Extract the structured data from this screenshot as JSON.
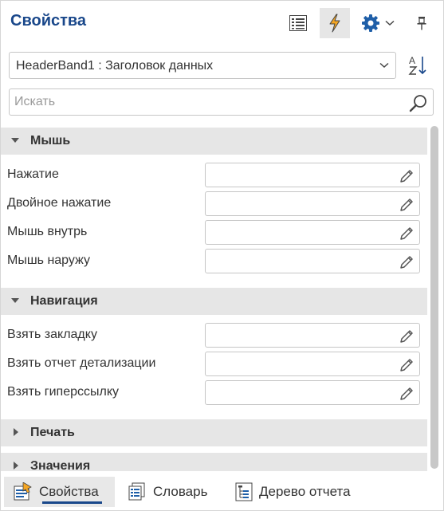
{
  "header": {
    "title": "Свойства"
  },
  "selector": {
    "value": "HeaderBand1 : Заголовок данных"
  },
  "search": {
    "placeholder": "Искать"
  },
  "categories": [
    {
      "label": "Мышь",
      "expanded": true,
      "properties": [
        {
          "label": "Нажатие",
          "value": ""
        },
        {
          "label": "Двойное нажатие",
          "value": ""
        },
        {
          "label": "Мышь внутрь",
          "value": ""
        },
        {
          "label": "Мышь наружу",
          "value": ""
        }
      ]
    },
    {
      "label": "Навигация",
      "expanded": true,
      "properties": [
        {
          "label": "Взять закладку",
          "value": ""
        },
        {
          "label": "Взять отчет детализации",
          "value": ""
        },
        {
          "label": "Взять гиперссылку",
          "value": ""
        }
      ]
    },
    {
      "label": "Печать",
      "expanded": false
    },
    {
      "label": "Значения",
      "expanded": false
    }
  ],
  "tabs": [
    {
      "label": "Свойства",
      "active": true,
      "icon": "properties-icon"
    },
    {
      "label": "Словарь",
      "active": false,
      "icon": "dictionary-icon"
    },
    {
      "label": "Дерево отчета",
      "active": false,
      "icon": "report-tree-icon"
    }
  ],
  "colors": {
    "accent": "#19478a",
    "events_icon": "#f5a623",
    "gear": "#1f5fa8"
  }
}
